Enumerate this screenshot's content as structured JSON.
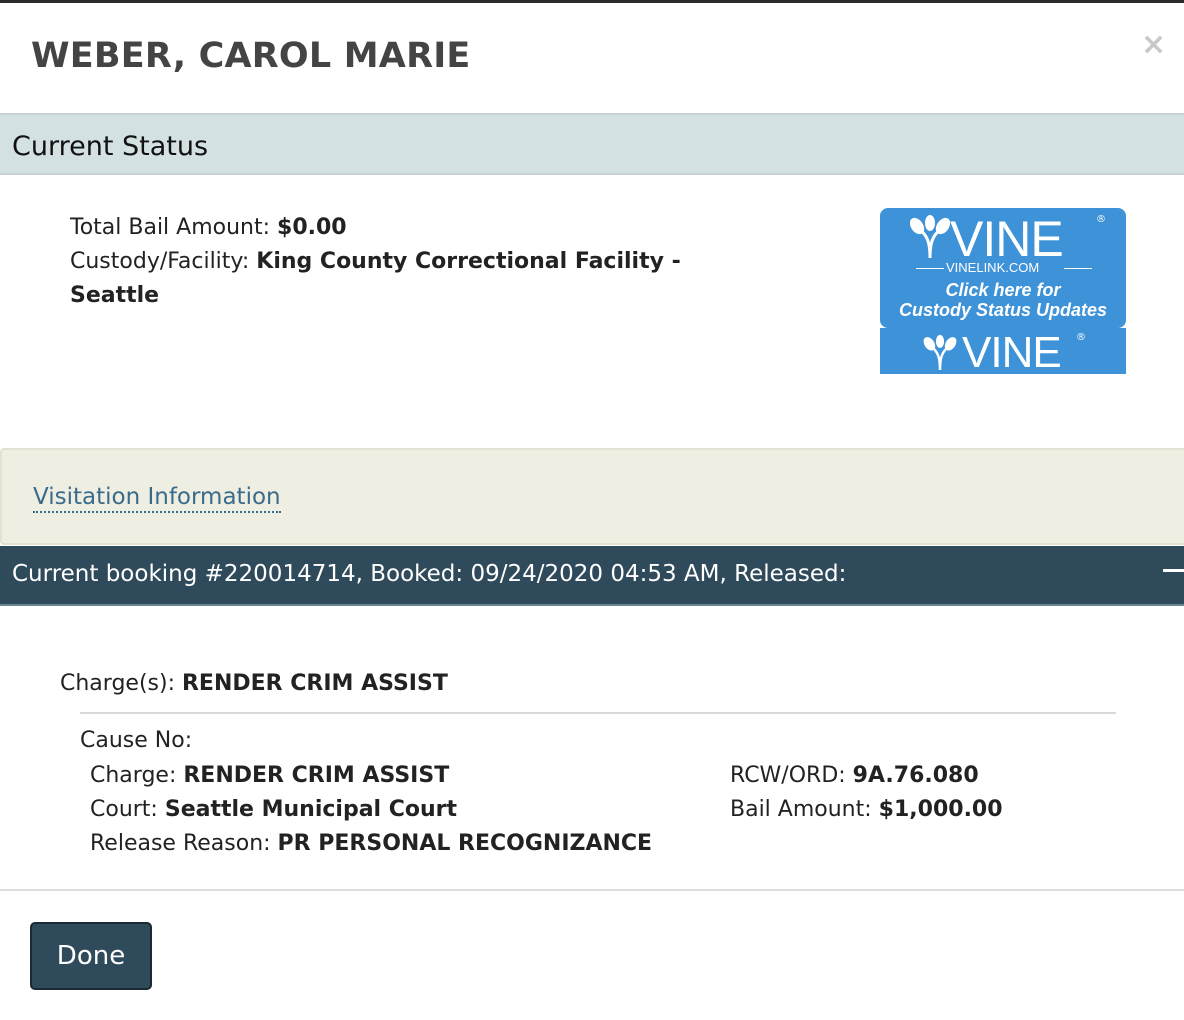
{
  "title": "WEBER, CAROL MARIE",
  "close_label": "×",
  "current_status": {
    "heading": "Current Status",
    "total_bail_label": "Total Bail Amount:",
    "total_bail_value": "$0.00",
    "custody_label": "Custody/Facility:",
    "custody_value_line1": "King County Correctional Facility -",
    "custody_value_line2": "Seattle"
  },
  "vine": {
    "logo_text": "VINE",
    "url_text": "VINELINK.COM",
    "cta_line1": "Click here for",
    "cta_line2": "Custody Status Updates",
    "registered": "®",
    "color": "#3e93d8"
  },
  "visitation": {
    "link_label": "Visitation Information"
  },
  "booking": {
    "header": "Current booking #220014714, Booked: 09/24/2020 04:53 AM, Released:",
    "charges_label": "Charge(s):",
    "charges_value": "RENDER CRIM ASSIST",
    "cause_label": "Cause No:",
    "charge_label": "Charge:",
    "charge_value": "RENDER CRIM ASSIST",
    "court_label": "Court:",
    "court_value": "Seattle Municipal Court",
    "release_reason_label": "Release Reason:",
    "release_reason_value": "PR PERSONAL RECOGNIZANCE",
    "rcw_label": "RCW/ORD:",
    "rcw_value": "9A.76.080",
    "bail_label": "Bail Amount:",
    "bail_value": "$1,000.00"
  },
  "footer": {
    "done_label": "Done"
  },
  "colors": {
    "status_header_bg": "#d4e1e2",
    "booking_header_bg": "#2f4a5a",
    "visit_panel_bg": "#efeee2",
    "link_color": "#3a6b8a"
  }
}
